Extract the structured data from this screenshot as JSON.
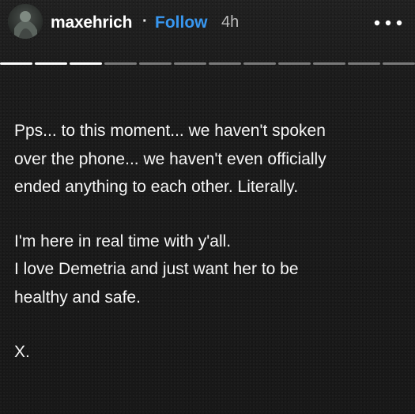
{
  "header": {
    "username": "maxehrich",
    "separator": "·",
    "follow_label": "Follow",
    "time": "4h"
  },
  "progress": {
    "total_segments": 12,
    "filled_segments": 3
  },
  "content": {
    "paragraphs": [
      "Pps... to this moment... we haven't spoken\nover the phone... we haven't even officially\nended anything to each other. Literally.",
      "I'm here in real time with y'all.\nI love Demetria and just want her to be\nhealthy and safe.",
      "X."
    ]
  },
  "icons": {
    "avatar": "avatar-image-icon",
    "more": "more-options-icon"
  },
  "colors": {
    "background": "#1b1b1b",
    "text": "#f6f6f6",
    "follow": "#3897f0",
    "muted": "#bdbdbd",
    "segment_filled": "#ffffff",
    "segment_unfilled": "#7a7a7a"
  }
}
